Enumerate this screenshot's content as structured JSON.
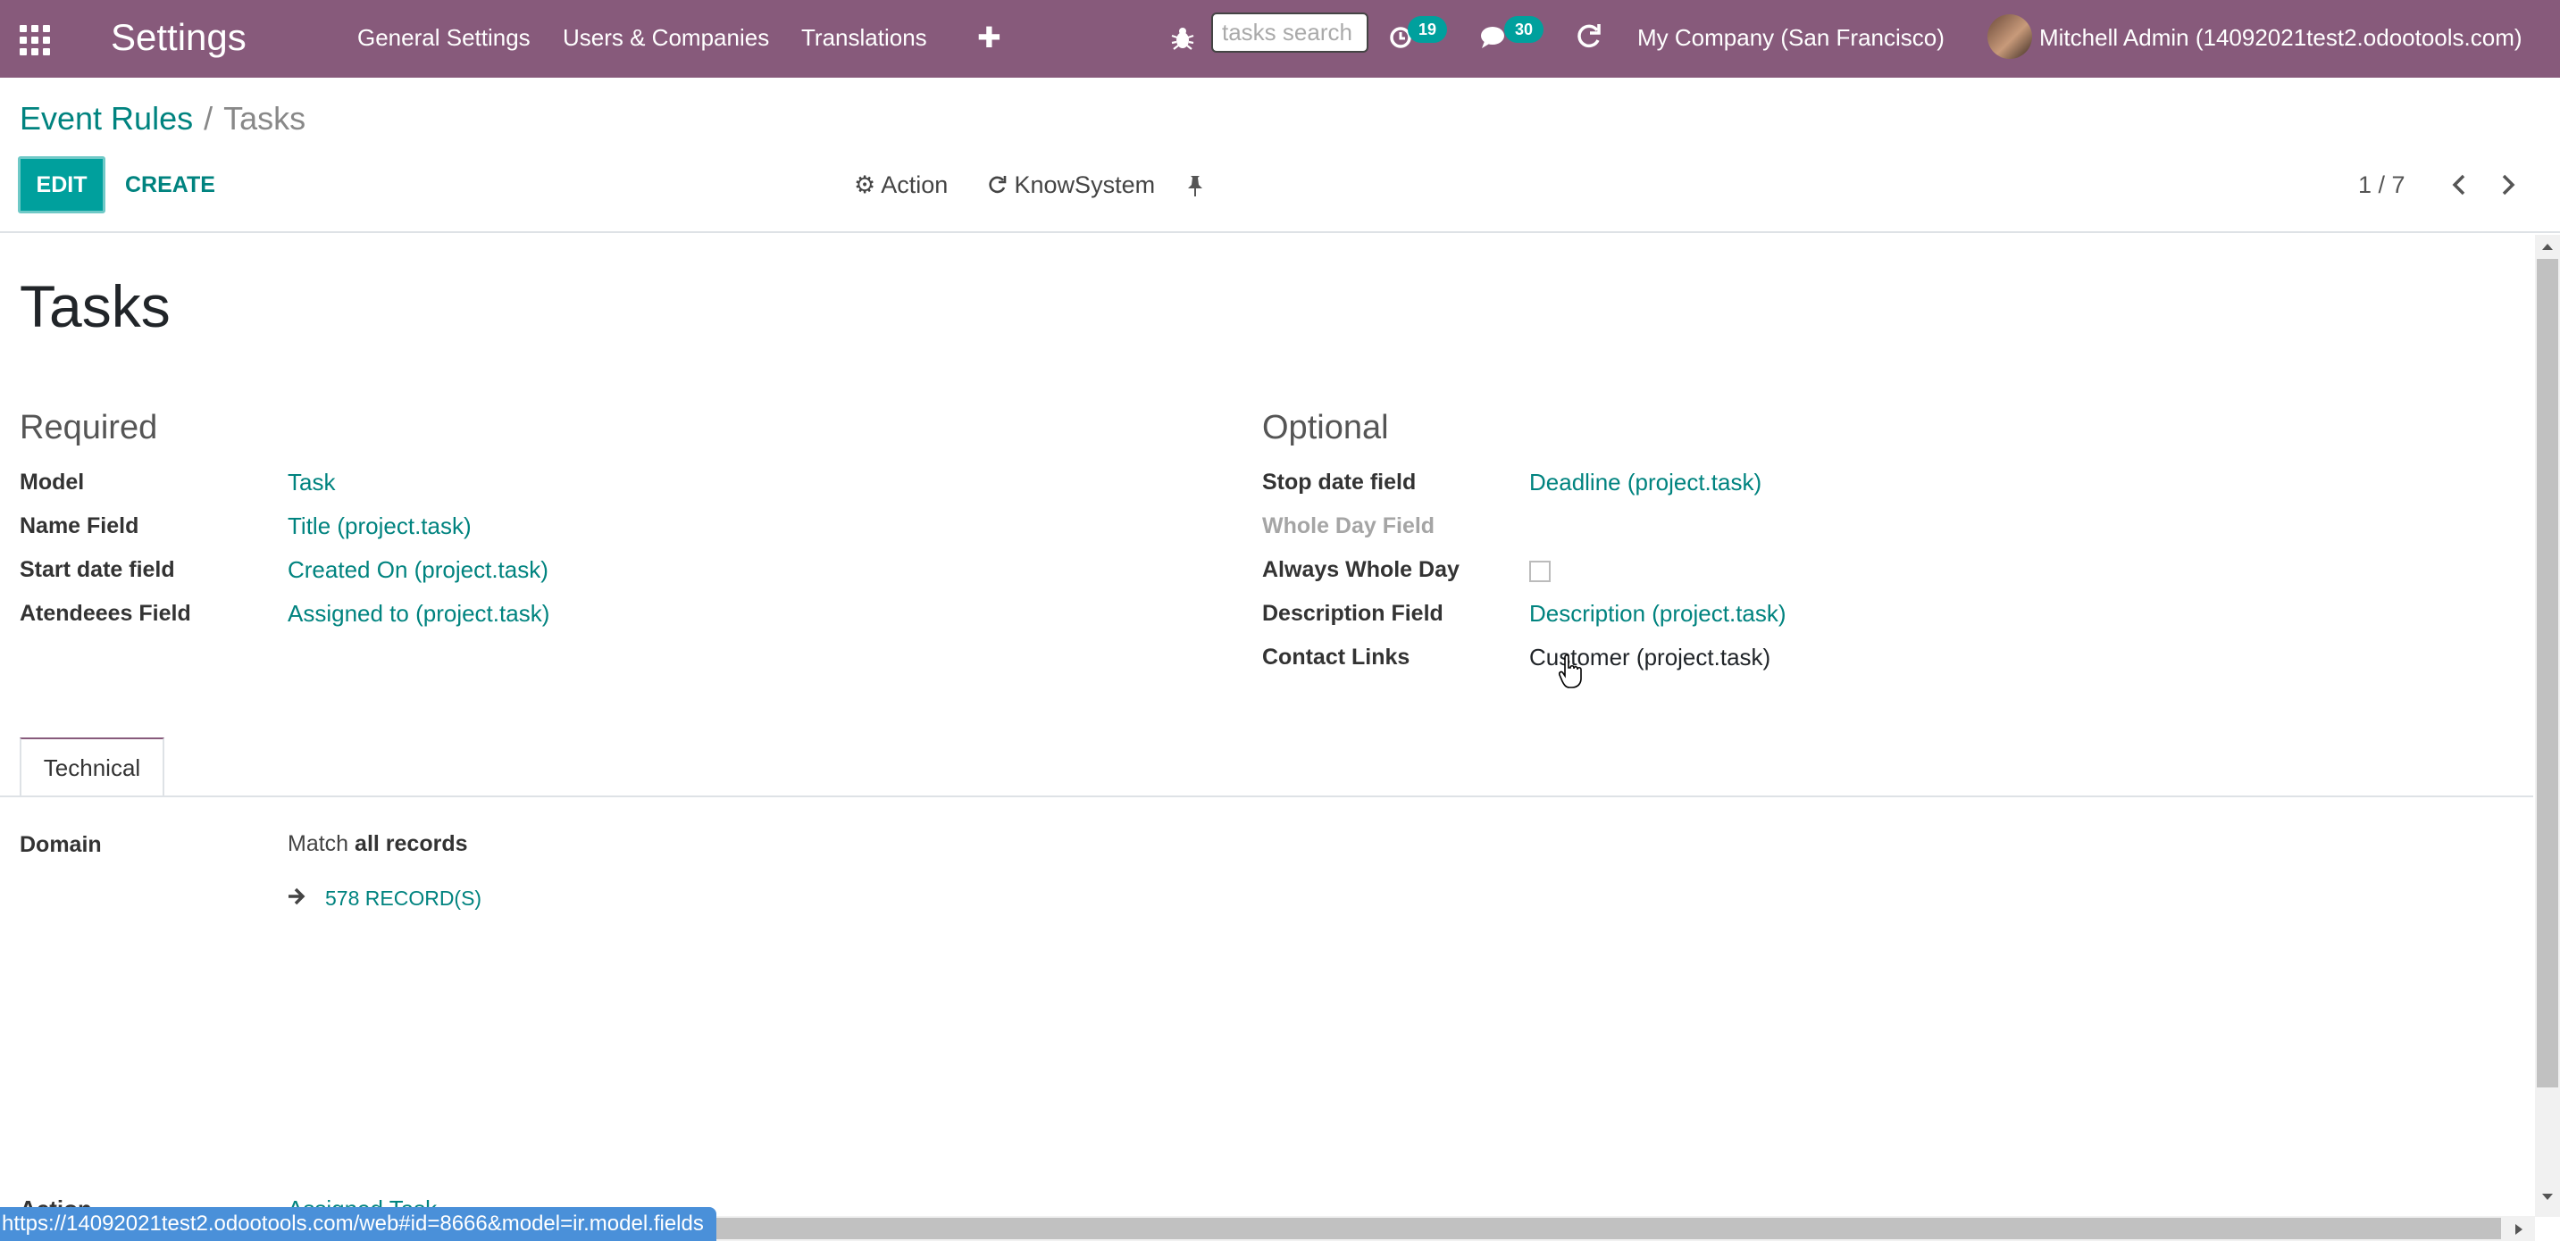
{
  "navbar": {
    "app_title": "Settings",
    "menu": [
      "General Settings",
      "Users & Companies",
      "Translations"
    ],
    "search_placeholder": "tasks search",
    "activity_count": "19",
    "messages_count": "30",
    "company": "My Company (San Francisco)",
    "user": "Mitchell Admin (14092021test2.odootools.com)"
  },
  "breadcrumb": {
    "parent": "Event Rules",
    "separator": "/",
    "current": "Tasks"
  },
  "control_panel": {
    "edit_label": "EDIT",
    "create_label": "CREATE",
    "action_label": "Action",
    "knowsystem_label": "KnowSystem",
    "pager": "1 / 7"
  },
  "form": {
    "title": "Tasks",
    "required": {
      "heading": "Required",
      "fields": [
        {
          "label": "Model",
          "value": "Task"
        },
        {
          "label": "Name Field",
          "value": "Title (project.task)"
        },
        {
          "label": "Start date field",
          "value": "Created On (project.task)"
        },
        {
          "label": "Atendeees Field",
          "value": "Assigned to (project.task)"
        }
      ]
    },
    "optional": {
      "heading": "Optional",
      "fields": [
        {
          "label": "Stop date field",
          "value": "Deadline (project.task)"
        },
        {
          "label": "Whole Day Field",
          "value": ""
        },
        {
          "label": "Always Whole Day",
          "value": false
        },
        {
          "label": "Description Field",
          "value": "Description (project.task)"
        },
        {
          "label": "Contact Links",
          "value": "Customer (project.task)"
        }
      ]
    },
    "tab_label": "Technical",
    "domain": {
      "label": "Domain",
      "match_prefix": "Match",
      "match_bold": "all records",
      "records_button": "578 RECORD(S)"
    },
    "cut_off": {
      "label": "Action",
      "value": "Assigned Task"
    }
  },
  "status_bar_url": "https://14092021test2.odootools.com/web#id=8666&model=ir.model.fields",
  "colors": {
    "navbar": "#875A7B",
    "primary": "#00A09D",
    "link": "#00837F",
    "badge": "#00A09D"
  },
  "icons": [
    "apps-grid-icon",
    "bug-icon",
    "clock-icon",
    "chat-icon",
    "refresh-icon",
    "plus-icon",
    "gear-icon",
    "pin-icon",
    "chevron-left-icon",
    "chevron-right-icon",
    "arrow-right-icon",
    "cursor-hand-icon"
  ]
}
